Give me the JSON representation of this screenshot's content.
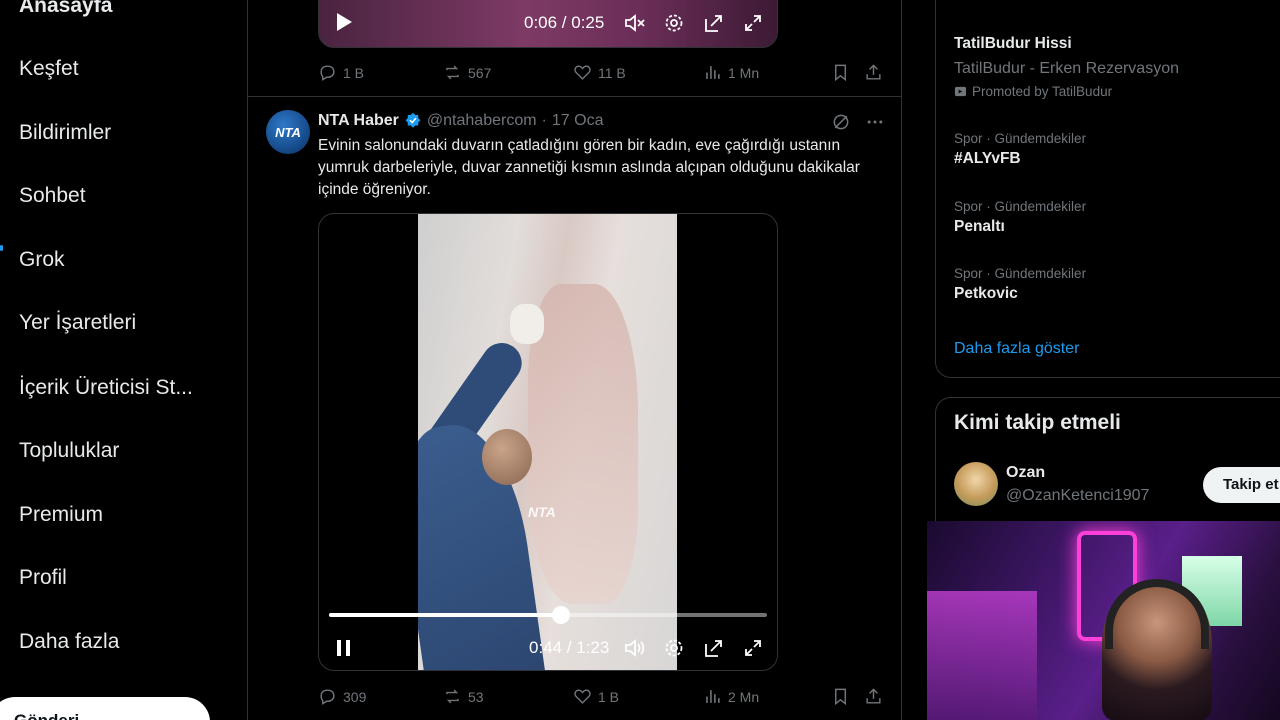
{
  "nav": {
    "items": [
      "Anasayfa",
      "Keşfet",
      "Bildirimler",
      "Sohbet",
      "Grok",
      "Yer İşaretleri",
      "İçerik Üreticisi St...",
      "Topluluklar",
      "Premium",
      "Profil",
      "Daha fazla"
    ],
    "account_partial": "Gönderi..."
  },
  "prev_video": {
    "time": "0:06 / 0:25",
    "stats": {
      "replies": "1 B",
      "reposts": "567",
      "likes": "11 B",
      "views": "1 Mn"
    }
  },
  "tweet": {
    "avatar_text": "NTA",
    "name": "NTA Haber",
    "handle": "@ntahabercom",
    "dot": "·",
    "date": "17 Oca",
    "text": "Evinin salonundaki duvarın çatladığını gören bir kadın, eve çağırdığı ustanın yumruk darbeleriyle, duvar zannetiği kısmın aslında alçıpan olduğunu dakikalar içinde öğreniyor.",
    "video": {
      "watermark": "NTA",
      "time": "0:44 / 1:23",
      "progress": 0.53
    },
    "stats": {
      "replies": "309",
      "reposts": "53",
      "likes": "1 B",
      "views": "2 Mn"
    }
  },
  "sidebar": {
    "promo": {
      "name": "TatilBudur Hissi",
      "subtitle": "TatilBudur - Erken Rezervasyon",
      "tag": "Promoted by TatilBudur"
    },
    "trends": [
      {
        "meta": "Spor · Gündemdekiler",
        "title": "#ALYvFB"
      },
      {
        "meta": "Spor · Gündemdekiler",
        "title": "Penaltı"
      },
      {
        "meta": "Spor · Gündemdekiler",
        "title": "Petkovic"
      }
    ],
    "show_more": "Daha fazla göster",
    "who_to_follow": {
      "title": "Kimi takip etmeli",
      "name": "Ozan",
      "handle": "@OzanKetenci1907",
      "button": "Takip et"
    }
  },
  "colors": {
    "accent": "#1d9bf0",
    "muted": "#71767b",
    "border": "#2f3336"
  }
}
